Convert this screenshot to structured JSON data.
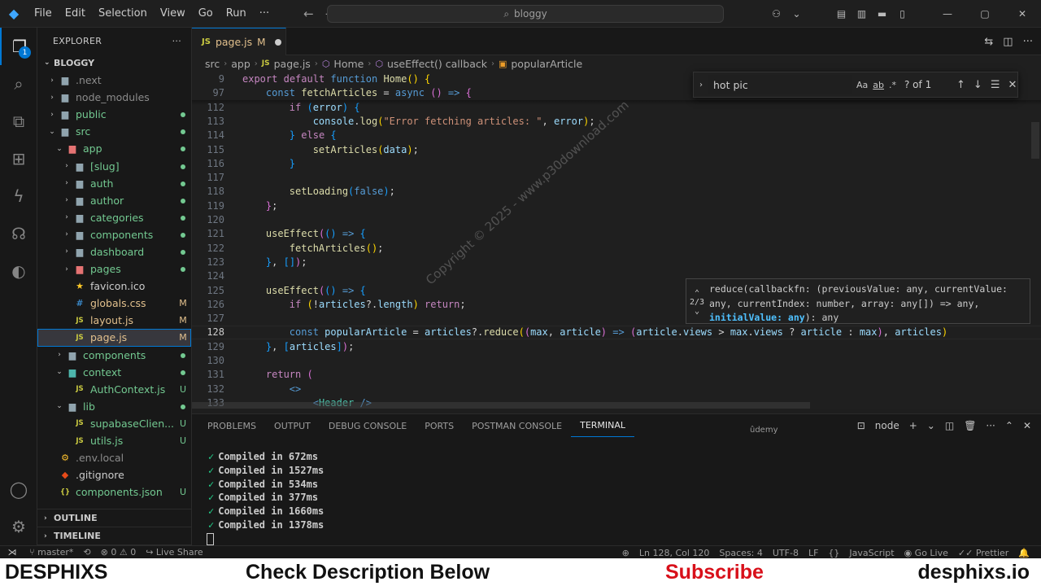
{
  "titlebar": {
    "menu": [
      "File",
      "Edit",
      "Selection",
      "View",
      "Go",
      "Run",
      "···"
    ],
    "search_text": "bloggy"
  },
  "activity": {
    "badge": "1"
  },
  "sidebar": {
    "title": "EXPLORER",
    "root": "BLOGGY",
    "items": [
      {
        "label": ".next",
        "depth": 1,
        "chev": "›",
        "kind": "folder",
        "color": "gray",
        "status": ""
      },
      {
        "label": "node_modules",
        "depth": 1,
        "chev": "›",
        "kind": "folder",
        "color": "gray",
        "status": ""
      },
      {
        "label": "public",
        "depth": 1,
        "chev": "›",
        "kind": "folder",
        "color": "green",
        "status": "dot"
      },
      {
        "label": "src",
        "depth": 1,
        "chev": "⌄",
        "kind": "folder",
        "color": "green",
        "status": "dot"
      },
      {
        "label": "app",
        "depth": 2,
        "chev": "⌄",
        "kind": "folder-red",
        "color": "green",
        "status": "dot"
      },
      {
        "label": "[slug]",
        "depth": 3,
        "chev": "›",
        "kind": "folder",
        "color": "green",
        "status": "dot"
      },
      {
        "label": "auth",
        "depth": 3,
        "chev": "›",
        "kind": "folder",
        "color": "green",
        "status": "dot"
      },
      {
        "label": "author",
        "depth": 3,
        "chev": "›",
        "kind": "folder",
        "color": "green",
        "status": "dot"
      },
      {
        "label": "categories",
        "depth": 3,
        "chev": "›",
        "kind": "folder",
        "color": "green",
        "status": "dot"
      },
      {
        "label": "components",
        "depth": 3,
        "chev": "›",
        "kind": "folder",
        "color": "green",
        "status": "dot"
      },
      {
        "label": "dashboard",
        "depth": 3,
        "chev": "›",
        "kind": "folder",
        "color": "green",
        "status": "dot"
      },
      {
        "label": "pages",
        "depth": 3,
        "chev": "›",
        "kind": "folder-red",
        "color": "green",
        "status": "dot"
      },
      {
        "label": "favicon.ico",
        "depth": 3,
        "chev": "",
        "kind": "star",
        "color": "normal",
        "status": ""
      },
      {
        "label": "globals.css",
        "depth": 3,
        "chev": "",
        "kind": "css",
        "color": "yellow",
        "status": "M"
      },
      {
        "label": "layout.js",
        "depth": 3,
        "chev": "",
        "kind": "js",
        "color": "yellow",
        "status": "M"
      },
      {
        "label": "page.js",
        "depth": 3,
        "chev": "",
        "kind": "js",
        "color": "yellow",
        "status": "M",
        "selected": true
      },
      {
        "label": "components",
        "depth": 2,
        "chev": "›",
        "kind": "folder",
        "color": "green",
        "status": "dot"
      },
      {
        "label": "context",
        "depth": 2,
        "chev": "⌄",
        "kind": "folder-teal",
        "color": "green",
        "status": "dot"
      },
      {
        "label": "AuthContext.js",
        "depth": 3,
        "chev": "",
        "kind": "js",
        "color": "green",
        "status": "U"
      },
      {
        "label": "lib",
        "depth": 2,
        "chev": "⌄",
        "kind": "folder",
        "color": "green",
        "status": "dot"
      },
      {
        "label": "supabaseClien...",
        "depth": 3,
        "chev": "",
        "kind": "js",
        "color": "green",
        "status": "U"
      },
      {
        "label": "utils.js",
        "depth": 3,
        "chev": "",
        "kind": "js",
        "color": "green",
        "status": "U"
      },
      {
        "label": ".env.local",
        "depth": 1,
        "chev": "",
        "kind": "env",
        "color": "gray",
        "status": ""
      },
      {
        "label": ".gitignore",
        "depth": 1,
        "chev": "",
        "kind": "git",
        "color": "normal",
        "status": ""
      },
      {
        "label": "components.json",
        "depth": 1,
        "chev": "",
        "kind": "json",
        "color": "green",
        "status": "U"
      }
    ],
    "outline": "OUTLINE",
    "timeline": "TIMELINE"
  },
  "tab": {
    "label": "page.js",
    "modified": "M"
  },
  "breadcrumb": [
    "src",
    "app",
    "page.js",
    "Home",
    "useEffect() callback",
    "popularArticle"
  ],
  "find": {
    "query": "hot pic",
    "count": "? of 1",
    "opt_case": "Aa",
    "opt_word": "ab",
    "opt_regex": ".*"
  },
  "editor": {
    "lines": [
      {
        "n": "9",
        "sticky": true
      },
      {
        "n": "97",
        "sticky": true
      },
      {
        "n": "112"
      },
      {
        "n": "113"
      },
      {
        "n": "114"
      },
      {
        "n": "115"
      },
      {
        "n": "116"
      },
      {
        "n": "117"
      },
      {
        "n": "118"
      },
      {
        "n": "119"
      },
      {
        "n": "120"
      },
      {
        "n": "121"
      },
      {
        "n": "122"
      },
      {
        "n": "123"
      },
      {
        "n": "124"
      },
      {
        "n": "125"
      },
      {
        "n": "126"
      },
      {
        "n": "127"
      },
      {
        "n": "128",
        "current": true
      },
      {
        "n": "129"
      },
      {
        "n": "130"
      },
      {
        "n": "131"
      },
      {
        "n": "132"
      },
      {
        "n": "133"
      }
    ]
  },
  "hover": {
    "counter": "2/3",
    "sig_pre": "reduce(callbackfn: (previousValue: any, currentValue: any, currentIndex: number, array: any[]) => any, ",
    "sig_hl": "initialValue: any",
    "sig_post": "): any"
  },
  "watermark": "Copyright © 2025 - www.p30download.com",
  "panel": {
    "tabs": [
      "PROBLEMS",
      "OUTPUT",
      "DEBUG CONSOLE",
      "PORTS",
      "POSTMAN CONSOLE",
      "TERMINAL"
    ],
    "active_tab": "TERMINAL",
    "udemy": "ûdemy",
    "shell": "node",
    "terminal_lines": [
      "Compiled in 672ms",
      "Compiled in 1527ms",
      "Compiled in 534ms",
      "Compiled in 377ms",
      "Compiled in 1660ms",
      "Compiled in 1378ms"
    ]
  },
  "status": {
    "branch": "master*",
    "errors": "0",
    "warnings": "0",
    "liveshare": "Live Share",
    "position": "Ln 128, Col 120",
    "spaces": "Spaces: 4",
    "encoding": "UTF-8",
    "eol": "LF",
    "language": "JavaScript",
    "golive": "Go Live",
    "prettier": "Prettier"
  },
  "banner": {
    "left": "DESPHIXS",
    "center": "Check Description Below",
    "subscribe": "Subscribe",
    "right": "desphixs.io"
  },
  "colors": {
    "accent": "#0078d4",
    "modified": "#e2c08d",
    "untracked": "#73c991",
    "subscribe": "#d8101a"
  }
}
